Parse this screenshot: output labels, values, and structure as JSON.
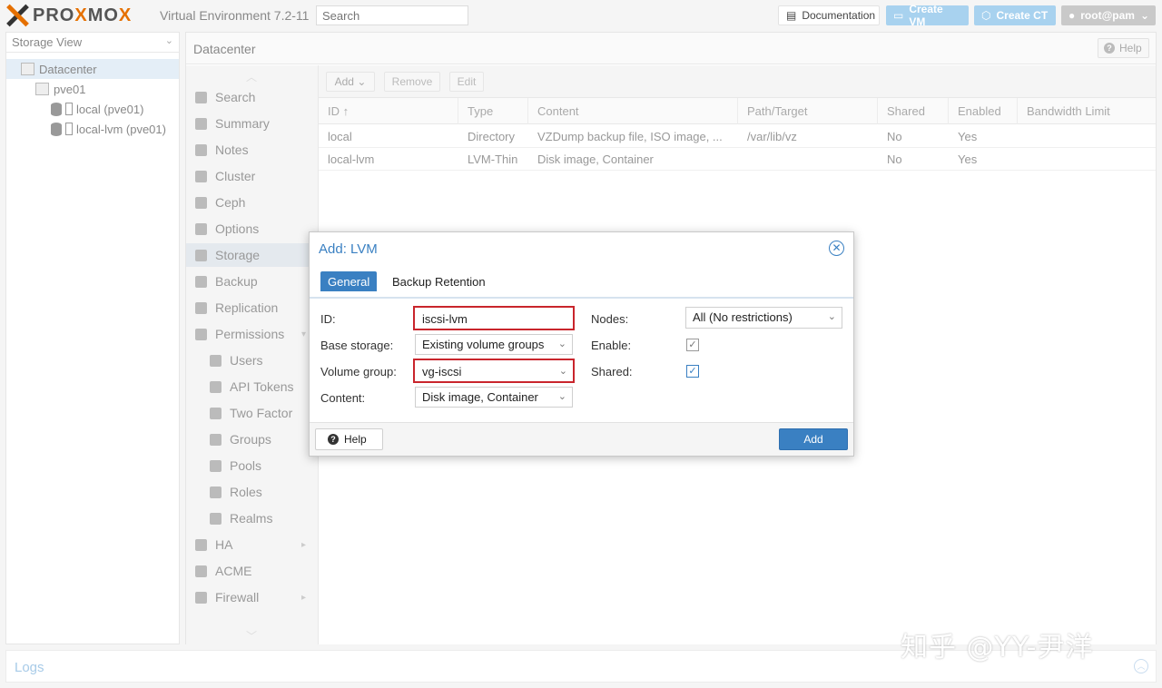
{
  "topbar": {
    "logo_text_a": "PRO",
    "logo_text_b": "X",
    "logo_text_c": "MO",
    "logo_text_d": "X",
    "version": "Virtual Environment 7.2-11",
    "search_placeholder": "Search",
    "documentation_label": "Documentation",
    "create_vm_label": "Create VM",
    "create_ct_label": "Create CT",
    "user_label": "root@pam"
  },
  "tree": {
    "view_label": "Storage View",
    "items": [
      {
        "label": "Datacenter"
      },
      {
        "label": "pve01"
      },
      {
        "label": "local (pve01)"
      },
      {
        "label": "local-lvm (pve01)"
      }
    ]
  },
  "content": {
    "title": "Datacenter",
    "help_label": "Help"
  },
  "menu": {
    "items": [
      {
        "label": "Search"
      },
      {
        "label": "Summary"
      },
      {
        "label": "Notes"
      },
      {
        "label": "Cluster"
      },
      {
        "label": "Ceph"
      },
      {
        "label": "Options"
      },
      {
        "label": "Storage"
      },
      {
        "label": "Backup"
      },
      {
        "label": "Replication"
      },
      {
        "label": "Permissions"
      },
      {
        "label": "Users"
      },
      {
        "label": "API Tokens"
      },
      {
        "label": "Two Factor"
      },
      {
        "label": "Groups"
      },
      {
        "label": "Pools"
      },
      {
        "label": "Roles"
      },
      {
        "label": "Realms"
      },
      {
        "label": "HA"
      },
      {
        "label": "ACME"
      },
      {
        "label": "Firewall"
      }
    ]
  },
  "grid": {
    "toolbar": {
      "add": "Add",
      "remove": "Remove",
      "edit": "Edit"
    },
    "columns": [
      "ID ↑",
      "Type",
      "Content",
      "Path/Target",
      "Shared",
      "Enabled",
      "Bandwidth Limit"
    ],
    "rows": [
      {
        "id": "local",
        "type": "Directory",
        "content": "VZDump backup file, ISO image, ...",
        "path": "/var/lib/vz",
        "shared": "No",
        "enabled": "Yes",
        "bw": ""
      },
      {
        "id": "local-lvm",
        "type": "LVM-Thin",
        "content": "Disk image, Container",
        "path": "",
        "shared": "No",
        "enabled": "Yes",
        "bw": ""
      }
    ]
  },
  "modal": {
    "title": "Add: LVM",
    "tabs": [
      "General",
      "Backup Retention"
    ],
    "labels": {
      "id": "ID:",
      "base_storage": "Base storage:",
      "volume_group": "Volume group:",
      "content": "Content:",
      "nodes": "Nodes:",
      "enable": "Enable:",
      "shared": "Shared:"
    },
    "values": {
      "id": "iscsi-lvm",
      "base_storage": "Existing volume groups",
      "volume_group": "vg-iscsi",
      "content": "Disk image, Container",
      "nodes": "All (No restrictions)"
    },
    "checks": {
      "enable": true,
      "shared": true
    },
    "help_label": "Help",
    "add_label": "Add"
  },
  "logs": {
    "title": "Logs"
  },
  "watermark": "知乎 @YY-尹洋",
  "colors": {
    "accent": "#3a80c2",
    "highlight": "#c9252c",
    "brand_orange": "#e57000"
  }
}
